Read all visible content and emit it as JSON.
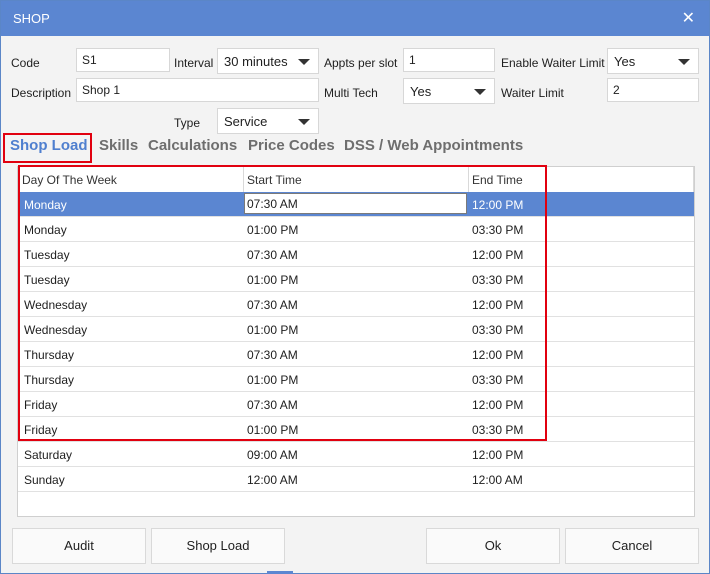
{
  "window": {
    "title": "SHOP",
    "close_glyph": "✕"
  },
  "form": {
    "code_label": "Code",
    "code_value": "S1",
    "interval_label": "Interval",
    "interval_value": "30 minutes",
    "appts_label": "Appts per slot",
    "appts_value": "1",
    "waiter_enable_label": "Enable Waiter Limit",
    "waiter_enable_value": "Yes",
    "description_label": "Description",
    "description_value": "Shop 1",
    "multitech_label": "Multi Tech",
    "multitech_value": "Yes",
    "waiter_limit_label": "Waiter Limit",
    "waiter_limit_value": "2",
    "type_label": "Type",
    "type_value": "Service"
  },
  "tabs": [
    {
      "label": "Shop Load",
      "active": true
    },
    {
      "label": "Skills"
    },
    {
      "label": "Calculations"
    },
    {
      "label": "Price Codes"
    },
    {
      "label": "DSS / Web Appointments"
    }
  ],
  "grid": {
    "headers": [
      "Day Of The Week",
      "Start Time",
      "End Time"
    ],
    "rows": [
      {
        "day": "Monday",
        "start": "07:30 AM",
        "end": "12:00 PM"
      },
      {
        "day": "Monday",
        "start": "01:00 PM",
        "end": "03:30 PM"
      },
      {
        "day": "Tuesday",
        "start": "07:30 AM",
        "end": "12:00 PM"
      },
      {
        "day": "Tuesday",
        "start": "01:00 PM",
        "end": "03:30 PM"
      },
      {
        "day": "Wednesday",
        "start": "07:30 AM",
        "end": "12:00 PM"
      },
      {
        "day": "Wednesday",
        "start": "01:00 PM",
        "end": "03:30 PM"
      },
      {
        "day": "Thursday",
        "start": "07:30 AM",
        "end": "12:00 PM"
      },
      {
        "day": "Thursday",
        "start": "01:00 PM",
        "end": "03:30 PM"
      },
      {
        "day": "Friday",
        "start": "07:30 AM",
        "end": "12:00 PM"
      },
      {
        "day": "Friday",
        "start": "01:00 PM",
        "end": "03:30 PM"
      },
      {
        "day": "Saturday",
        "start": "09:00 AM",
        "end": "12:00 PM"
      },
      {
        "day": "Sunday",
        "start": "12:00 AM",
        "end": "12:00 AM"
      }
    ]
  },
  "buttons": {
    "audit": "Audit",
    "shop_load": "Shop Load",
    "ok": "Ok",
    "cancel": "Cancel"
  },
  "colors": {
    "accent": "#5b86d1",
    "highlight_box": "#e1000f"
  }
}
